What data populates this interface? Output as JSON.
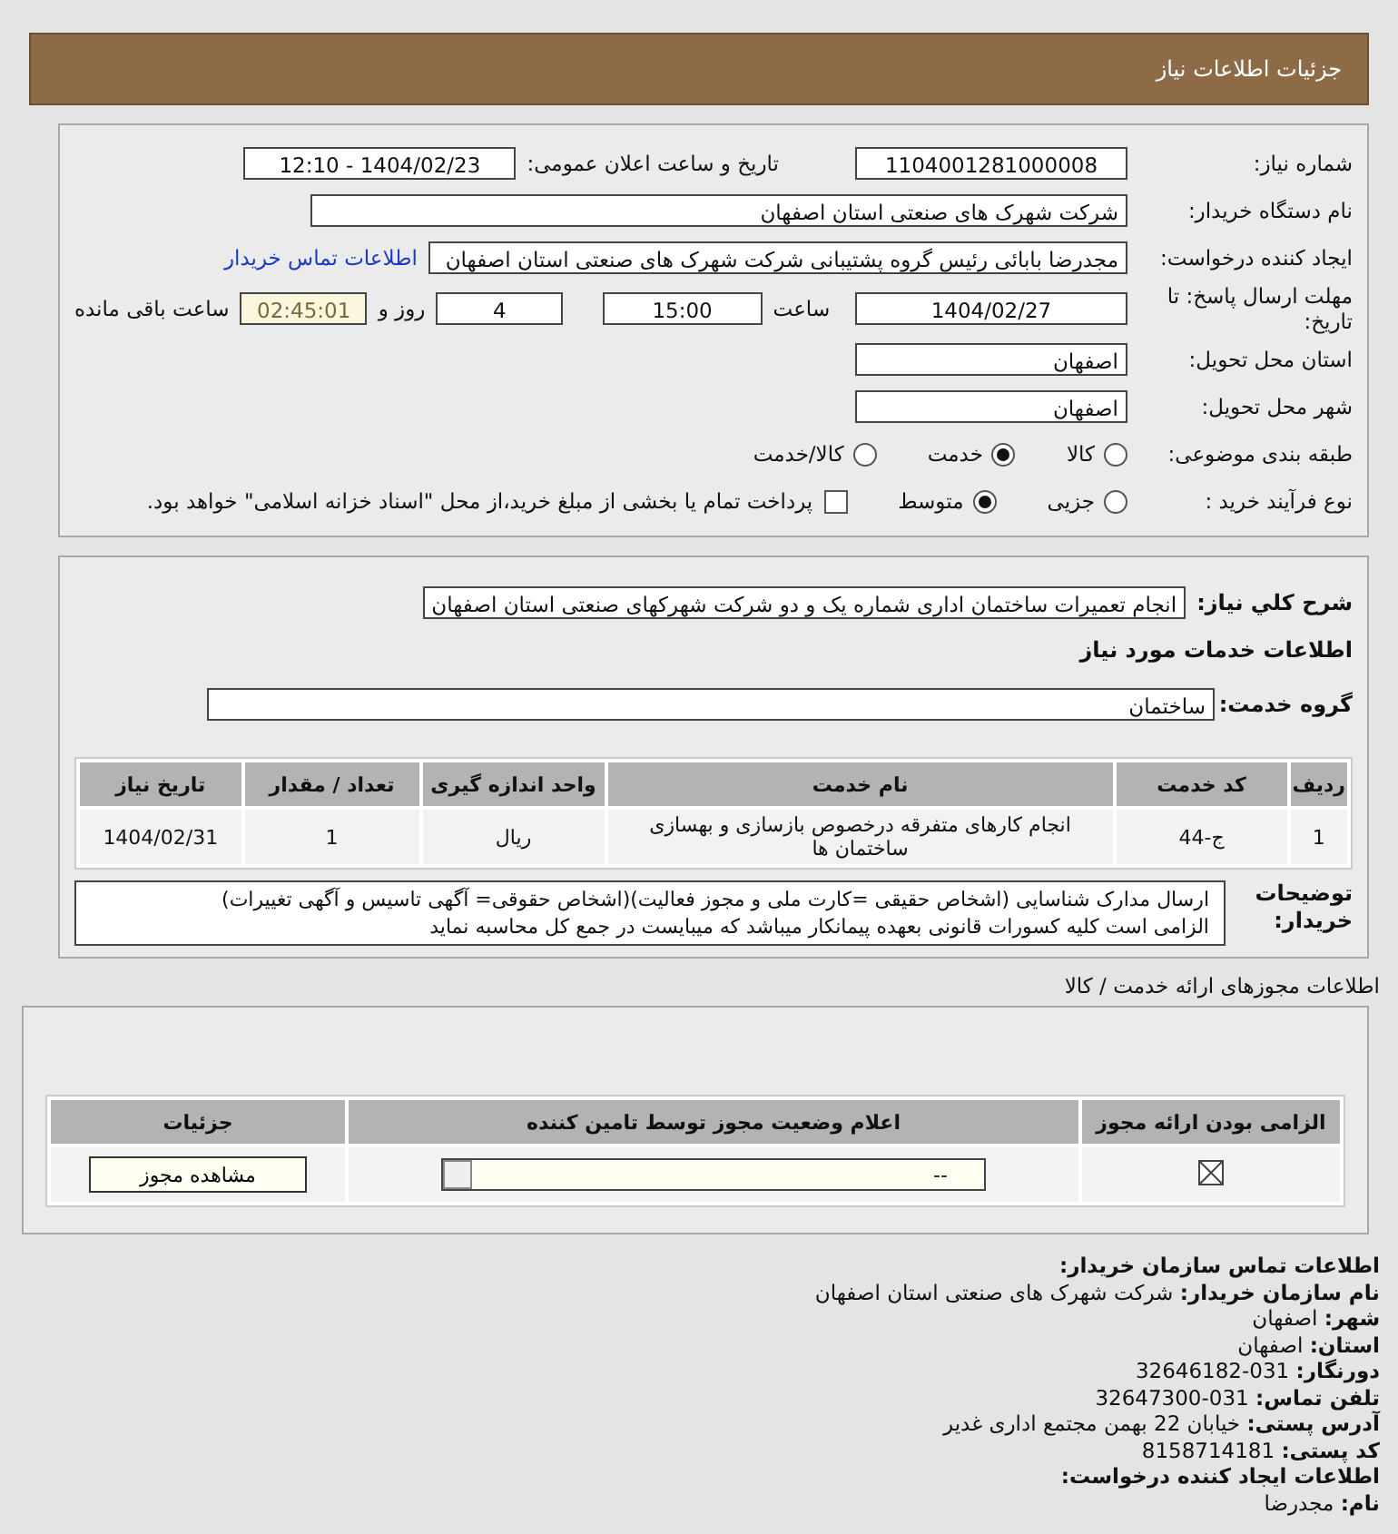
{
  "header": {
    "title": "جزئیات اطلاعات نیاز"
  },
  "details": {
    "need_number": {
      "label": "شماره نیاز:",
      "value": "1104001281000008"
    },
    "announce": {
      "label": "تاریخ و ساعت اعلان عمومی:",
      "value": "1404/02/23 - 12:10"
    },
    "buyer": {
      "label": "نام دستگاه خریدار:",
      "value": "شرکت شهرک های صنعتی استان اصفهان"
    },
    "creator": {
      "label": "ایجاد کننده درخواست:",
      "value": "مجدرضا بابائی رئیس گروه پشتیبانی شرکت شهرک های صنعتی استان اصفهان",
      "link": "اطلاعات تماس خریدار"
    },
    "deadline": {
      "label": "مهلت ارسال پاسخ: تا تاریخ:",
      "date": "1404/02/27",
      "time_label": "ساعت",
      "time": "15:00",
      "days": "4",
      "days_label": "روز و",
      "remaining": "02:45:01",
      "remaining_label": "ساعت باقی مانده"
    },
    "province": {
      "label": "استان محل تحویل:",
      "value": "اصفهان"
    },
    "city": {
      "label": "شهر محل تحویل:",
      "value": "اصفهان"
    },
    "category": {
      "label": "طبقه بندی موضوعی:",
      "options": [
        {
          "label": "کالا",
          "selected": false
        },
        {
          "label": "خدمت",
          "selected": true
        },
        {
          "label": "کالا/خدمت",
          "selected": false
        }
      ]
    },
    "process": {
      "label": "نوع فرآیند خرید :",
      "options": [
        {
          "label": "جزیی",
          "selected": false
        },
        {
          "label": "متوسط",
          "selected": true
        }
      ],
      "payment": {
        "checked": false,
        "text": "پرداخت تمام یا بخشی از مبلغ خرید،از محل \"اسناد خزانه اسلامی\" خواهد بود."
      }
    }
  },
  "services": {
    "summary": {
      "label": "شرح کلي نياز:",
      "value": "انجام تعمیرات ساختمان اداری شماره یک و دو شرکت شهرکهای صنعتی استان اصفهان"
    },
    "heading": "اطلاعات خدمات مورد نیاز",
    "group": {
      "label": "گروه خدمت:",
      "value": "ساختمان"
    },
    "table": {
      "columns": [
        "ردیف",
        "کد خدمت",
        "نام خدمت",
        "واحد اندازه گیری",
        "تعداد / مقدار",
        "تاریخ نیاز"
      ],
      "rows": [
        [
          "1",
          "ج-44",
          "انجام کارهای متفرقه درخصوص بازسازی و بهسازی ساختمان ها",
          "ریال",
          "1",
          "1404/02/31"
        ]
      ]
    },
    "notes": {
      "label": "توضیحات خریدار:",
      "lines": [
        "ارسال مدارک شناسایی (اشخاص حقیقی =کارت ملی و مجوز فعالیت)(اشخاص حقوقی= آگهی تاسیس و آگهی تغییرات)",
        "الزامی است کلیه کسورات قانونی بعهده پیمانکار میباشد که میبایست در جمع کل محاسبه نماید"
      ]
    }
  },
  "permits": {
    "title": "اطلاعات مجوزهای ارائه خدمت / کالا",
    "columns": [
      "الزامی بودن ارائه مجوز",
      "اعلام وضعیت مجوز توسط تامین کننده",
      "جزئیات"
    ],
    "rows": [
      {
        "required": true,
        "status": "--",
        "button": "مشاهده مجوز"
      }
    ]
  },
  "contact": [
    {
      "kind": "heading",
      "label": "اطلاعات تماس سازمان خریدار:"
    },
    {
      "kind": "field",
      "label": "نام سازمان خریدار:",
      "value": "شرکت شهرک های صنعتی استان اصفهان"
    },
    {
      "kind": "field",
      "label": "شهر:",
      "value": "اصفهان"
    },
    {
      "kind": "field",
      "label": "استان:",
      "value": "اصفهان"
    },
    {
      "kind": "field",
      "label": "دورنگار:",
      "value": "031-32646182"
    },
    {
      "kind": "field",
      "label": "تلفن تماس:",
      "value": "031-32647300"
    },
    {
      "kind": "field",
      "label": "آدرس پستی:",
      "value": "خیابان 22 بهمن مجتمع اداری غدیر"
    },
    {
      "kind": "field",
      "label": "کد پستی:",
      "value": "8158714181"
    },
    {
      "kind": "heading",
      "label": "اطلاعات ایجاد کننده درخواست:"
    },
    {
      "kind": "field",
      "label": "نام:",
      "value": "مجدرضا"
    }
  ]
}
